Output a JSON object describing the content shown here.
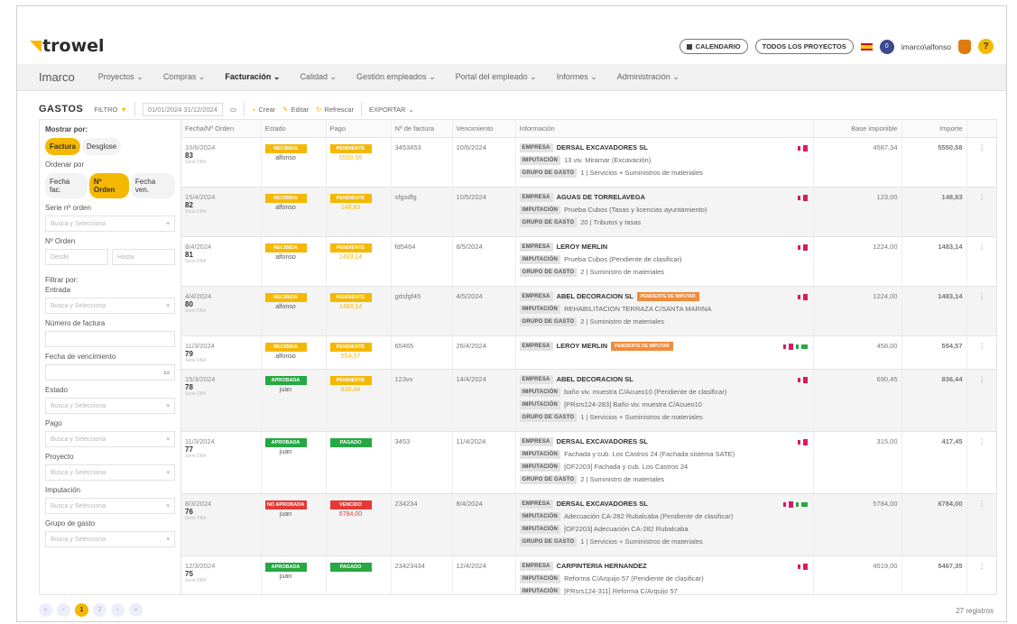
{
  "app": {
    "logo_text": "trowel"
  },
  "topbar": {
    "calendar_label": "CALENDARIO",
    "projects_label": "TODOS LOS PROYECTOS",
    "notifications_count": "0",
    "username": "imarco\\alfonso",
    "help_label": "?"
  },
  "nav": {
    "brand": "Imarco",
    "items": [
      "Proyectos",
      "Compras",
      "Facturación",
      "Calidad",
      "Gestión empleados",
      "Portal del empleado",
      "Informes",
      "Administración"
    ],
    "active": "Facturación"
  },
  "toolbar": {
    "title": "GASTOS",
    "filter_label": "FILTRO",
    "date_range": "01/01/2024 31/12/2024",
    "create_label": "Crear",
    "edit_label": "Editar",
    "refresh_label": "Refrescar",
    "export_label": "EXPORTAR"
  },
  "sidebar": {
    "show_by_label": "Mostrar por:",
    "show_by_options": [
      "Factura",
      "Desglose"
    ],
    "order_by_label": "Ordenar por",
    "order_by_options": [
      "Fecha fac.",
      "Nº Orden",
      "Fecha ven."
    ],
    "serie_label": "Serie nº orden",
    "select_placeholder": "Busca y Selecciona",
    "order_no_label": "Nº Orden",
    "from_placeholder": "Desde",
    "to_placeholder": "Hasta",
    "filter_by_label": "Filtrar por:",
    "entered_label": "Entrada",
    "invoice_number_label": "Número de factura",
    "due_date_label": "Fecha de vencimiento",
    "status_label": "Estado",
    "payment_label": "Pago",
    "project_label": "Proyecto",
    "imputation_label": "Imputación",
    "expense_group_label": "Grupo de gasto"
  },
  "columns": [
    "Fecha/Nº Orden",
    "Estado",
    "Pago",
    "Nº de factura",
    "Vencimiento",
    "Información",
    "Base imponible",
    "Importe",
    ""
  ],
  "labels": {
    "empresa": "EMPRESA",
    "imputacion": "IMPUTACIÓN",
    "grupo": "GRUPO DE GASTO",
    "pending_imputation": "PENDIENTE DE IMPUTAR",
    "serie": "Serie DBA",
    "more": "⋮"
  },
  "rows": [
    {
      "date": "10/6/2024",
      "order": "83",
      "status": "RECIBIDA",
      "status_class": "b-rec",
      "user": "alfonso",
      "pay": "PENDIENTE",
      "pay_class": "b-pen",
      "pay_amt": "5550,58",
      "pay_amt_class": "sub-y",
      "invoice": "3453453",
      "due": "10/6/2024",
      "company": "DERSAL EXCAVADORES SL",
      "pending": "",
      "imputations": [
        "13 viv. Miramar (Excavación)"
      ],
      "group": "1 | Servicios + Suministros de materiales",
      "icons": "pdf",
      "base": "4587,34",
      "total": "5550,58"
    },
    {
      "date": "15/4/2024",
      "order": "82",
      "status": "RECIBIDA",
      "status_class": "b-rec",
      "user": "alfonso",
      "pay": "PENDIENTE",
      "pay_class": "b-pen",
      "pay_amt": "148,83",
      "pay_amt_class": "sub-y",
      "invoice": "sfgsdfg",
      "due": "10/5/2024",
      "company": "AGUAS DE TORRELAVEGA",
      "pending": "",
      "imputations": [
        "Prueba Cubos (Tasas y licencias ayuntamiento)"
      ],
      "group": "20 | Tributos y tasas",
      "icons": "pdf",
      "base": "123,00",
      "total": "148,83"
    },
    {
      "date": "8/4/2024",
      "order": "81",
      "status": "RECIBIDA",
      "status_class": "b-rec",
      "user": "alfonso",
      "pay": "PENDIENTE",
      "pay_class": "b-pen",
      "pay_amt": "1483,14",
      "pay_amt_class": "sub-y",
      "invoice": "fd5464",
      "due": "8/5/2024",
      "company": "LEROY MERLIN",
      "pending": "",
      "imputations": [
        "Prueba Cubos (Pendiente de clasificar)"
      ],
      "group": "2 | Suministro de materiales",
      "icons": "pdf",
      "base": "1224,00",
      "total": "1483,14"
    },
    {
      "date": "4/4/2024",
      "order": "80",
      "status": "RECIBIDA",
      "status_class": "b-rec",
      "user": "alfonso",
      "pay": "PENDIENTE",
      "pay_class": "b-pen",
      "pay_amt": "1483,14",
      "pay_amt_class": "sub-y",
      "invoice": "gdsfgf45",
      "due": "4/5/2024",
      "company": "ABEL DECORACION SL",
      "pending": "PENDIENTE DE IMPUTAR",
      "imputations": [
        "REHABILITACION TERRAZA C/SANTA MARINA"
      ],
      "group": "2 | Suministro de materiales",
      "icons": "pdf",
      "base": "1224,00",
      "total": "1483,14"
    },
    {
      "date": "11/3/2024",
      "order": "79",
      "status": "RECIBIDA",
      "status_class": "b-rec",
      "user": "alfonso",
      "pay": "PENDIENTE",
      "pay_class": "b-pen",
      "pay_amt": "554,57",
      "pay_amt_class": "sub-y",
      "invoice": "65465",
      "due": "26/4/2024",
      "company": "LEROY MERLIN",
      "pending": "PENDIENTE DE IMPUTAR",
      "imputations": [],
      "group": "",
      "icons": "pdf2cash",
      "base": "458,00",
      "total": "554,57"
    },
    {
      "date": "15/3/2024",
      "order": "78",
      "status": "APROBADA",
      "status_class": "b-apr",
      "user": "juan",
      "pay": "PENDIENTE",
      "pay_class": "b-pen",
      "pay_amt": "836,44",
      "pay_amt_class": "sub-y",
      "invoice": "123vv",
      "due": "14/4/2024",
      "company": "ABEL DECORACION SL",
      "pending": "",
      "imputations": [
        "baño viv. muestra C/Acueo10 (Pendiente de clasificar)",
        "[PRsrs124-283] Baño viv. muestra C/Acueo10"
      ],
      "group": "1 | Servicios + Suministros de materiales",
      "icons": "pdf",
      "base": "690,45",
      "total": "836,44"
    },
    {
      "date": "11/3/2024",
      "order": "77",
      "status": "APROBADA",
      "status_class": "b-apr",
      "user": "juan",
      "pay": "PAGADO",
      "pay_class": "b-pag",
      "pay_amt": "",
      "pay_amt_class": "sub-y",
      "invoice": "3453",
      "due": "11/4/2024",
      "company": "DERSAL EXCAVADORES SL",
      "pending": "",
      "imputations": [
        "Fachada y cub. Los Castros 24 (Fachada sistema SATE)",
        "[OF2203] Fachada y cub. Los Castros 24"
      ],
      "group": "2 | Suministro de materiales",
      "icons": "pdf",
      "base": "315,00",
      "total": "417,45"
    },
    {
      "date": "8/3/2024",
      "order": "76",
      "status": "NO APROBADA",
      "status_class": "b-no",
      "user": "juan",
      "pay": "VENCIDO",
      "pay_class": "b-ven",
      "pay_amt": "6784,00",
      "pay_amt_class": "sub-r",
      "invoice": "234234",
      "due": "8/4/2024",
      "company": "DERSAL EXCAVADORES SL",
      "pending": "",
      "imputations": [
        "Adecuación CA-282 Rubalcaba (Pendiente de clasificar)",
        "[OF2203] Adecuación CA-282 Rubalcaba"
      ],
      "group": "1 | Servicios + Suministros de materiales",
      "icons": "pdf2cash",
      "base": "5784,00",
      "total": "6784,00"
    },
    {
      "date": "12/3/2024",
      "order": "75",
      "status": "APROBADA",
      "status_class": "b-apr",
      "user": "juan",
      "pay": "PAGADO",
      "pay_class": "b-pag",
      "pay_amt": "",
      "pay_amt_class": "sub-y",
      "invoice": "23423434",
      "due": "12/4/2024",
      "company": "CARPINTERIA HERNANDEZ",
      "pending": "",
      "imputations": [
        "Reforma C/Arquijo 57 (Pendiente de clasificar)",
        "[PRsrs124-311] Reforma C/Arquijo 57"
      ],
      "group": "",
      "icons": "pdf",
      "base": "4519,00",
      "total": "5467,35"
    }
  ],
  "pager": {
    "pages": [
      "«",
      "‹",
      "1",
      "2",
      "›",
      "»"
    ],
    "active": "1",
    "records": "27 registros"
  },
  "colors": {
    "accent": "#f5b800",
    "success": "#26a843",
    "danger": "#e53935",
    "warning": "#f08c3c"
  }
}
